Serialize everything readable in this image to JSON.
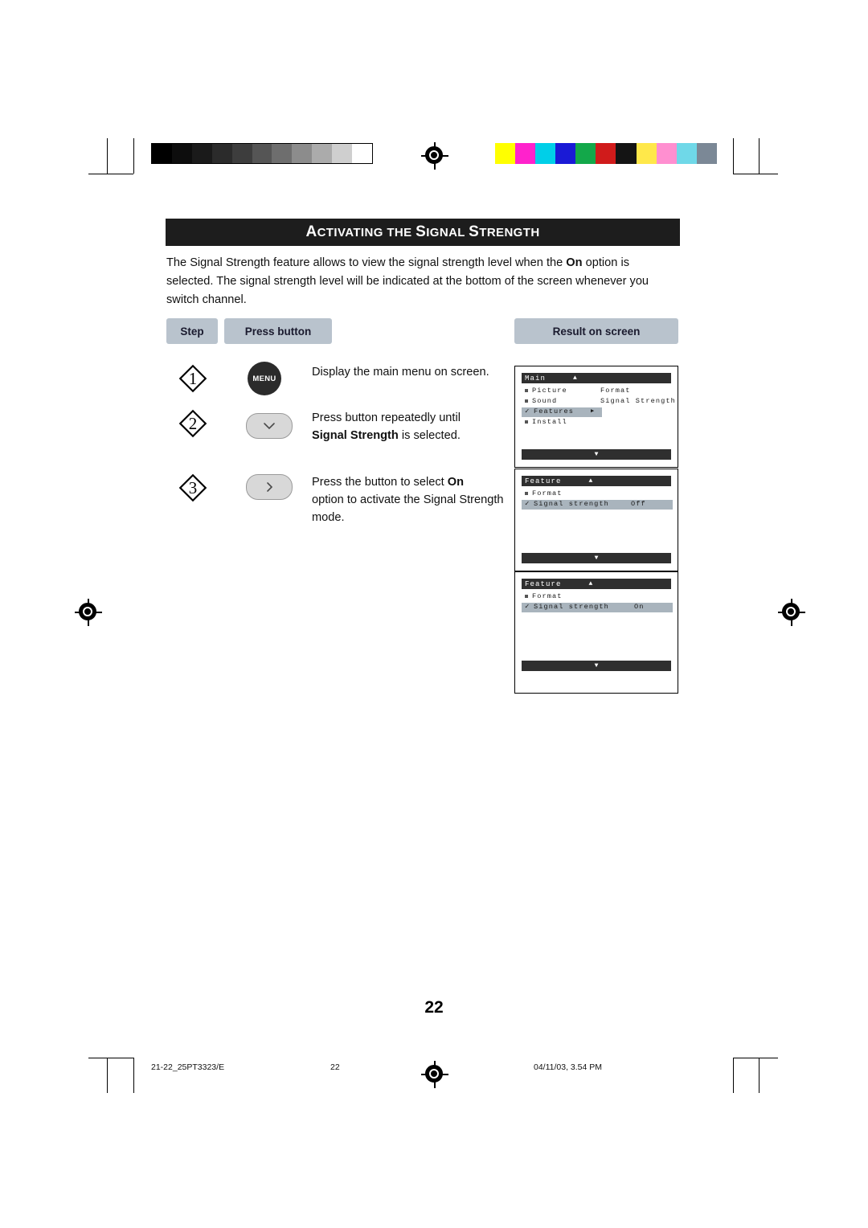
{
  "header": {
    "title_small_caps_parts": [
      "A",
      "CTIVATING THE ",
      "S",
      "IGNAL ",
      "S",
      "TRENGTH"
    ],
    "title": "ACTIVATING THE SIGNAL STRENGTH"
  },
  "intro": {
    "line1_a": "The Signal Strength feature allows to view the signal strength level when the ",
    "line1_bold": "On",
    "line1_b": " option is",
    "line2": "selected. The signal strength level will be indicated at the bottom of the screen whenever you",
    "line3": "switch channel."
  },
  "columns": {
    "step": "Step",
    "press_button": "Press button",
    "result_on_screen": "Result on screen"
  },
  "steps": [
    {
      "number": "1",
      "button_label": "MENU",
      "button_icon": "menu-text-button",
      "instruction": "Display the main menu on screen."
    },
    {
      "number": "2",
      "button_label": "",
      "button_icon": "chevron-down-icon",
      "instruction_a": "Press button repeatedly until",
      "instruction_bold": "Signal Strength",
      "instruction_b": " is selected."
    },
    {
      "number": "3",
      "button_label": "",
      "button_icon": "chevron-right-icon",
      "instruction_a": "Press the button to select ",
      "instruction_bold": "On",
      "instruction_b": "option to activate the Signal Strength",
      "instruction_c": "mode."
    }
  ],
  "osd": {
    "screen1": {
      "title": "Main",
      "up_arrow": "▲",
      "down_arrow": "▼",
      "rows": [
        {
          "marker": "bullet",
          "label": "Picture",
          "col2": "Format"
        },
        {
          "marker": "bullet",
          "label": "Sound",
          "col2": "Signal Strength"
        },
        {
          "marker": "check",
          "label": "Features",
          "col2": "▶",
          "highlight": true
        },
        {
          "marker": "bullet",
          "label": "Install",
          "col2": ""
        }
      ]
    },
    "screen2": {
      "title": "Feature",
      "up_arrow": "▲",
      "down_arrow": "▼",
      "rows": [
        {
          "marker": "bullet",
          "label": "Format",
          "col2": ""
        },
        {
          "marker": "check",
          "label": "Signal strength",
          "col2": "Off",
          "highlight": true
        }
      ]
    },
    "screen3": {
      "title": "Feature",
      "up_arrow": "▲",
      "down_arrow": "▼",
      "rows": [
        {
          "marker": "bullet",
          "label": "Format",
          "col2": ""
        },
        {
          "marker": "check",
          "label": "Signal strength",
          "col2": "On",
          "highlight": true
        }
      ]
    }
  },
  "page_number": "22",
  "footer": {
    "left": "21-22_25PT3323/E",
    "center": "22",
    "right": "04/11/03, 3.54 PM"
  },
  "colorbars": {
    "grayscale": [
      "#000000",
      "#111111",
      "#222222",
      "#333333",
      "#4d4d4d",
      "#666666",
      "#808080",
      "#999999",
      "#b3b3b3",
      "#cccccc",
      "#ffffff"
    ],
    "color": [
      "#ffff00",
      "#ff00cc",
      "#00ccff",
      "#0000cc",
      "#00aa44",
      "#cc1111",
      "#000000",
      "#ffee44",
      "#ff88cc",
      "#66ddee",
      "#778899"
    ]
  }
}
